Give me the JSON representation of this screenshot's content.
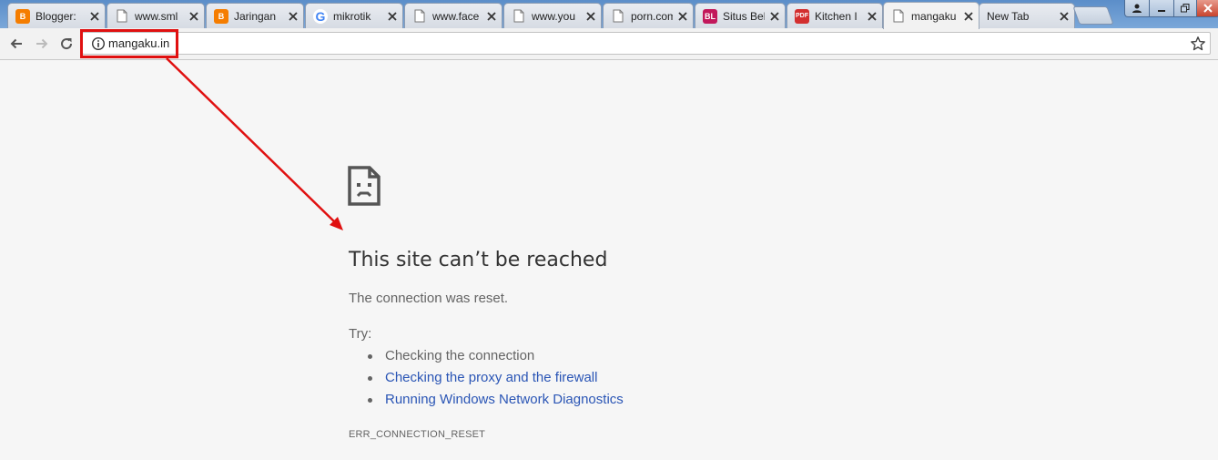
{
  "colors": {
    "highlight_red": "#e01010",
    "link_blue": "#2a55b5",
    "text_gray": "#646464",
    "title_gray": "#333333",
    "page_bg": "#f6f6f6"
  },
  "tabs": [
    {
      "title": "Blogger:",
      "icon": "blogger-icon"
    },
    {
      "title": "www.sml",
      "icon": "page-icon"
    },
    {
      "title": "Jaringan",
      "icon": "blogger-icon"
    },
    {
      "title": "mikrotik",
      "icon": "google-icon"
    },
    {
      "title": "www.face",
      "icon": "page-icon"
    },
    {
      "title": "www.you",
      "icon": "page-icon"
    },
    {
      "title": "porn.com",
      "icon": "page-icon"
    },
    {
      "title": "Situs Bel",
      "icon": "bl-icon",
      "icon_text": "BL"
    },
    {
      "title": "Kitchen I",
      "icon": "pdf-icon",
      "icon_text": "PDF"
    },
    {
      "title": "mangaku",
      "icon": "page-icon",
      "active": true
    },
    {
      "title": "New Tab",
      "icon": "none"
    }
  ],
  "toolbar": {
    "url": "mangaku.in"
  },
  "error": {
    "title": "This site can’t be reached",
    "message": "The connection was reset.",
    "try_label": "Try:",
    "suggestions": [
      {
        "text": "Checking the connection",
        "link": false
      },
      {
        "text": "Checking the proxy and the firewall",
        "link": true
      },
      {
        "text": "Running Windows Network Diagnostics",
        "link": true
      }
    ],
    "code": "ERR_CONNECTION_RESET"
  }
}
